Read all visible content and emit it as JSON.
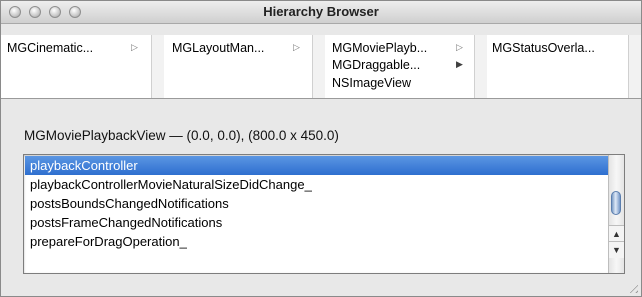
{
  "window": {
    "title": "Hierarchy Browser"
  },
  "browser": {
    "columns": [
      {
        "items": [
          {
            "label": "MGCinematic...",
            "arrow": "▷"
          }
        ]
      },
      {
        "items": [
          {
            "label": "MGLayoutMan...",
            "arrow": "▷"
          }
        ]
      },
      {
        "items": [
          {
            "label": "MGMoviePlayb...",
            "arrow": "▷"
          },
          {
            "label": "MGDraggable...",
            "arrow": "▶"
          },
          {
            "label": "NSImageView",
            "arrow": ""
          }
        ]
      },
      {
        "items": [
          {
            "label": "MGStatusOverla...",
            "arrow": ""
          }
        ]
      }
    ]
  },
  "detail": {
    "label": "MGMoviePlaybackView — (0.0, 0.0), (800.0 x 450.0)"
  },
  "list": {
    "items": [
      "playbackController",
      "playbackControllerMovieNaturalSizeDidChange_",
      "postsBoundsChangedNotifications",
      "postsFrameChangedNotifications",
      "prepareForDragOperation_"
    ],
    "selected_index": 0,
    "scroll_up": "▲",
    "scroll_down": "▼"
  },
  "colors": {
    "selection": "#3a7bd5",
    "window_bg": "#e8e8e8"
  }
}
